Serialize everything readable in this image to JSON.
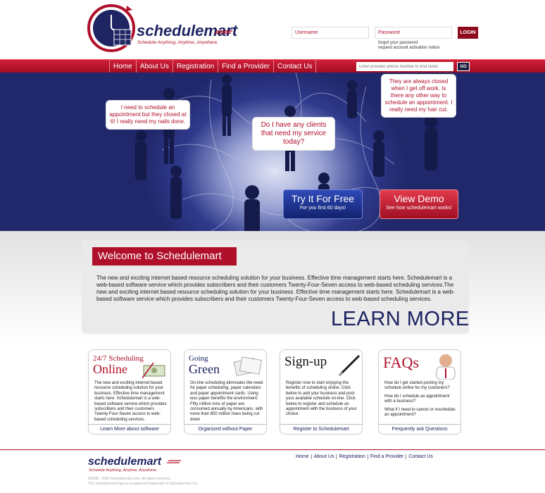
{
  "brand": {
    "name": "schedulemart",
    "tagline": "Schedule Anything, Anytime, Anywhere."
  },
  "login": {
    "username_placeholder": "Username",
    "password_placeholder": "Password",
    "login_label": "LOGIN",
    "forgot_password": "forgot your password",
    "request_activation": "request account activation notice"
  },
  "nav": {
    "items": [
      "Home",
      "About Us",
      "Registration",
      "Find a Provider",
      "Contact Us"
    ],
    "search_placeholder": "Enter provider phone number to find faster",
    "go_label": "GO"
  },
  "hero": {
    "bubble_left": "I need to schedule an appointment but they closed at 6! I really need my nails done.",
    "bubble_center": "Do I have any clients that need my service today?",
    "bubble_right": "They are always closed when I get off work.  Is there any other way to schedule an appointment.  I really need my hair cut.",
    "cta_try_title": "Try It For Free",
    "cta_try_sub": "For you first 60 days!",
    "cta_demo_title": "View Demo",
    "cta_demo_sub": "See how schedulemart works!"
  },
  "welcome": {
    "title": "Welcome to Schedulemart",
    "text": "The new and exciting internet based resource scheduling solution for your business.  Effective time management starts here. Schedulemart is a web-based software service which provides subscribers and their customers Twenty-Four-Seven access to web-based scheduling services.The new and exciting internet based resource scheduling solution for your business.  Effective time management starts here. Schedulemart is a web-based software service which provides subscribers and their customers Twenty-Four-Seven access to web-based scheduling services.",
    "learn_more": "LEARN MORE"
  },
  "cards": [
    {
      "title_top": "24/7 Scheduling",
      "title_main": "Online",
      "body": "The new and exciting internet based resource scheduling solution for your business.  Effective time management starts here. Schedulemart is a web-based software service which provides subscribers and their customers Twenty-Four-Seven access to web-based scheduling services.",
      "link": "Learn More about software"
    },
    {
      "title_top": "Going",
      "title_main": "Green",
      "body": "On-line scheduling eliminates the need for paper scheduling, paper calendars and paper appointment cards. Using less paper benefits the environment. Fifty million tons of paper are consumed annually by Americans, with more than 850 million trees being cut down",
      "link": "Organized without Paper"
    },
    {
      "title_main": "Sign-up",
      "body": "Register now to start enjoying the benefits of scheduling online. Click below to add your business and post your available schedule on-line.  Click below to register and schedule an appointment with the business of your choice.",
      "link": "Register to Schedulemart"
    },
    {
      "title_main": "FAQs",
      "body_lines": [
        "How do I get started posting my schedule online for my customers?",
        "How do I schedule an appointment with a business?",
        "What if I need to cancel or reschedule an appointment?"
      ],
      "link": "Frequently ask Questions"
    }
  ],
  "footer": {
    "links": [
      "Home",
      "About Us",
      "Registration",
      "Find a Provider",
      "Contact Us"
    ],
    "copyright": "©2008 - 2009 Schedulemart.com. All rights reserved.",
    "trademark": "The Schedulemart logo is a registered trademark of Schedulemart, Inc."
  },
  "colors": {
    "brand_red": "#b0102a",
    "brand_navy": "#1a2260",
    "hero_blue": "#2f3a8c"
  }
}
